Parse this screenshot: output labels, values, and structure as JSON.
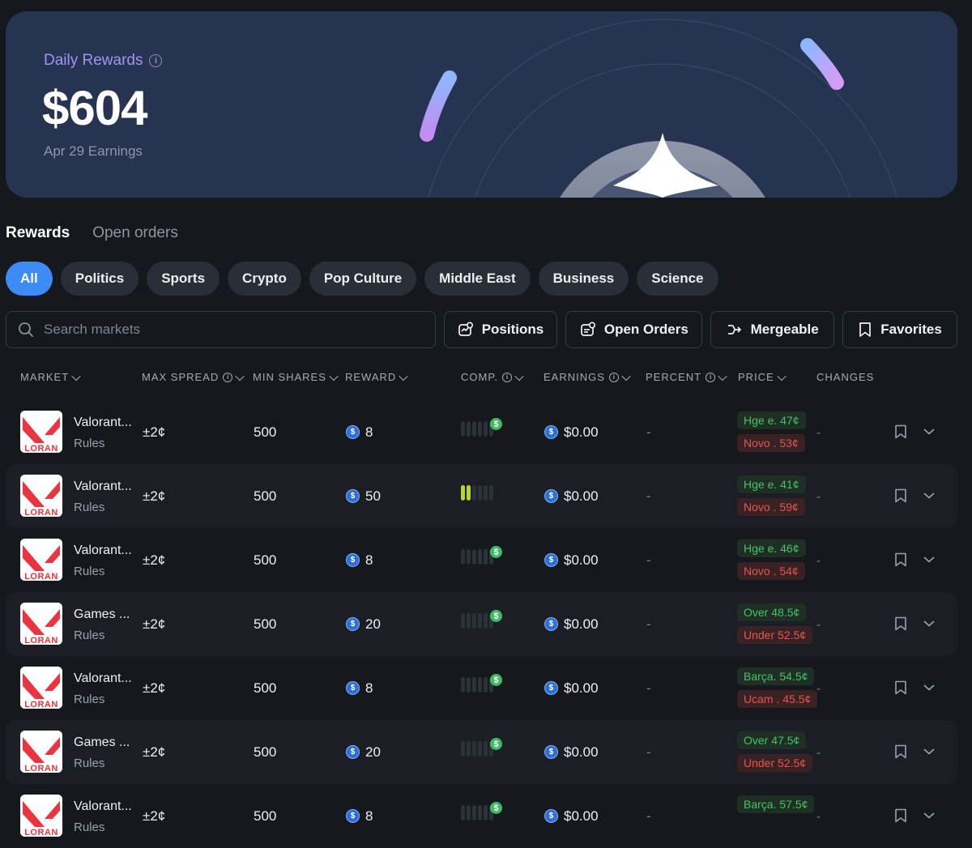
{
  "hero": {
    "title": "Daily Rewards",
    "amount": "$604",
    "subtitle": "Apr 29 Earnings"
  },
  "tabs": [
    {
      "label": "Rewards",
      "active": true
    },
    {
      "label": "Open orders",
      "active": false
    }
  ],
  "categories": [
    {
      "label": "All",
      "active": true
    },
    {
      "label": "Politics"
    },
    {
      "label": "Sports"
    },
    {
      "label": "Crypto"
    },
    {
      "label": "Pop Culture"
    },
    {
      "label": "Middle East"
    },
    {
      "label": "Business"
    },
    {
      "label": "Science"
    }
  ],
  "search": {
    "placeholder": "Search markets",
    "value": ""
  },
  "toolbar": {
    "positions": "Positions",
    "open_orders": "Open Orders",
    "mergeable": "Mergeable",
    "favorites": "Favorites"
  },
  "columns": {
    "market": "MARKET",
    "max_spread": "MAX SPREAD",
    "min_shares": "MIN SHARES",
    "reward": "REWARD",
    "comp": "COMP.",
    "earnings": "EARNINGS",
    "percent": "PERCENT",
    "price": "PRICE",
    "changes": "CHANGES"
  },
  "logo_text": "LORAN",
  "rows": [
    {
      "market": "Valorant...",
      "rules": "Rules",
      "spread": "±2¢",
      "min_shares": "500",
      "reward": "8",
      "comp_level": 0,
      "comp_dollar": true,
      "earnings": "$0.00",
      "percent": "-",
      "yes": "Hge e. 47¢",
      "no": "Novo . 53¢",
      "change": "-"
    },
    {
      "market": "Valorant...",
      "rules": "Rules",
      "spread": "±2¢",
      "min_shares": "500",
      "reward": "50",
      "comp_level": 2,
      "comp_dollar": false,
      "earnings": "$0.00",
      "percent": "-",
      "yes": "Hge e. 41¢",
      "no": "Novo . 59¢",
      "change": "-"
    },
    {
      "market": "Valorant...",
      "rules": "Rules",
      "spread": "±2¢",
      "min_shares": "500",
      "reward": "8",
      "comp_level": 0,
      "comp_dollar": true,
      "earnings": "$0.00",
      "percent": "-",
      "yes": "Hge e. 46¢",
      "no": "Novo . 54¢",
      "change": "-"
    },
    {
      "market": "Games ...",
      "rules": "Rules",
      "spread": "±2¢",
      "min_shares": "500",
      "reward": "20",
      "comp_level": 0,
      "comp_dollar": true,
      "earnings": "$0.00",
      "percent": "-",
      "yes": "Over 48.5¢",
      "no": "Under 52.5¢",
      "change": "-"
    },
    {
      "market": "Valorant...",
      "rules": "Rules",
      "spread": "±2¢",
      "min_shares": "500",
      "reward": "8",
      "comp_level": 0,
      "comp_dollar": true,
      "earnings": "$0.00",
      "percent": "-",
      "yes": "Barça. 54.5¢",
      "no": "Ucam . 45.5¢",
      "change": "-"
    },
    {
      "market": "Games ...",
      "rules": "Rules",
      "spread": "±2¢",
      "min_shares": "500",
      "reward": "20",
      "comp_level": 0,
      "comp_dollar": true,
      "earnings": "$0.00",
      "percent": "-",
      "yes": "Over 47.5¢",
      "no": "Under 52.5¢",
      "change": "-"
    },
    {
      "market": "Valorant...",
      "rules": "Rules",
      "spread": "±2¢",
      "min_shares": "500",
      "reward": "8",
      "comp_level": 0,
      "comp_dollar": true,
      "earnings": "$0.00",
      "percent": "-",
      "yes": "Barça. 57.5¢",
      "no": "",
      "change": "-"
    }
  ],
  "colors": {
    "accent": "#3d8cf5",
    "yes": "#45c36a",
    "no": "#e0584f",
    "comp": "#b5d433"
  }
}
